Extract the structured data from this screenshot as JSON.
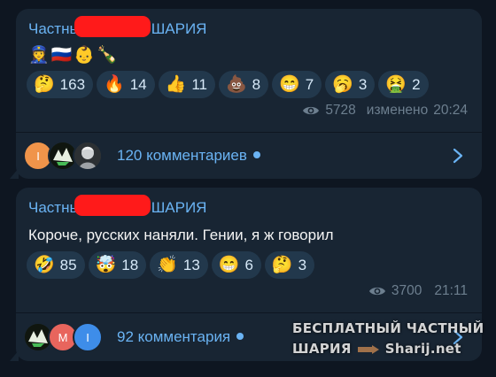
{
  "messages": [
    {
      "author": "Частны ШАРИЯ",
      "author_prefix": "Частны",
      "author_suffix": "ШАРИЯ",
      "text": "👮‍♀️🇷🇺👶🍾",
      "reactions": [
        {
          "emoji": "🤔",
          "count": "163"
        },
        {
          "emoji": "🔥",
          "count": "14"
        },
        {
          "emoji": "👍",
          "count": "11"
        },
        {
          "emoji": "💩",
          "count": "8"
        },
        {
          "emoji": "😁",
          "count": "7"
        },
        {
          "emoji": "🥱",
          "count": "3"
        },
        {
          "emoji": "🤮",
          "count": "2"
        }
      ],
      "views": "5728",
      "edited_label": "изменено",
      "time": "20:24",
      "comments_label": "120 комментариев",
      "comment_avatars": [
        "I",
        "",
        ""
      ]
    },
    {
      "author": "Частны ШАРИЯ",
      "author_prefix": "Частны",
      "author_suffix": "ШАРИЯ",
      "text": "Короче, русских наняли. Гении, я ж говорил",
      "reactions": [
        {
          "emoji": "🤣",
          "count": "85"
        },
        {
          "emoji": "🤯",
          "count": "18"
        },
        {
          "emoji": "👏",
          "count": "13"
        },
        {
          "emoji": "😁",
          "count": "6"
        },
        {
          "emoji": "🤔",
          "count": "3"
        }
      ],
      "views": "3700",
      "time": "21:11",
      "comments_label": "92 комментария",
      "comment_avatars": [
        "",
        "M",
        "I"
      ]
    }
  ],
  "watermark": {
    "line1": "БЕСПЛАТНЫЙ ЧАСТНЫЙ",
    "line2_left": "ШАРИЯ",
    "line2_right": "Sharij.net"
  },
  "colors": {
    "background": "#0e1621",
    "bubble": "#182533",
    "accent": "#6ab3f3",
    "reaction_bg": "#22384c",
    "meta": "#6d7f8f",
    "redaction": "#ff1a1a"
  },
  "icons": [
    "eye-icon",
    "chevron-right-icon",
    "unread-dot-icon",
    "pointing-hand-icon"
  ]
}
